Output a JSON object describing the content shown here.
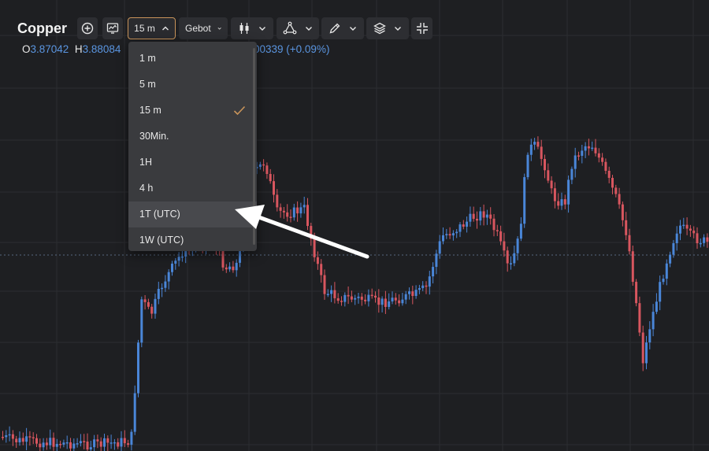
{
  "header": {
    "title": "Copper",
    "timeframe_label": "15 m",
    "price_type_label": "Gebot"
  },
  "ohlc": {
    "open_key": "O",
    "open_value": "3.87042",
    "high_key": "H",
    "high_value": "3.88084",
    "change_value": "00339 (+0.09%)"
  },
  "timeframe_menu": {
    "items": [
      {
        "label": "1 m"
      },
      {
        "label": "5 m"
      },
      {
        "label": "15 m",
        "selected": true
      },
      {
        "label": "30Min."
      },
      {
        "label": "1H"
      },
      {
        "label": "4 h"
      },
      {
        "label": "1T (UTC)",
        "hovered": true
      },
      {
        "label": "1W (UTC)"
      }
    ]
  },
  "icons": [
    "add-icon",
    "indicator-icon",
    "chevron-up-icon",
    "chevron-down-icon",
    "candlestick-icon",
    "drawing-tools-icon",
    "pencil-icon",
    "layers-icon",
    "collapse-icon",
    "check-icon"
  ],
  "colors": {
    "background": "#1e1f22",
    "bull": "#4a86d8",
    "bear": "#d8565f",
    "accent": "#c9945a",
    "grid": "#2c2d31"
  }
}
